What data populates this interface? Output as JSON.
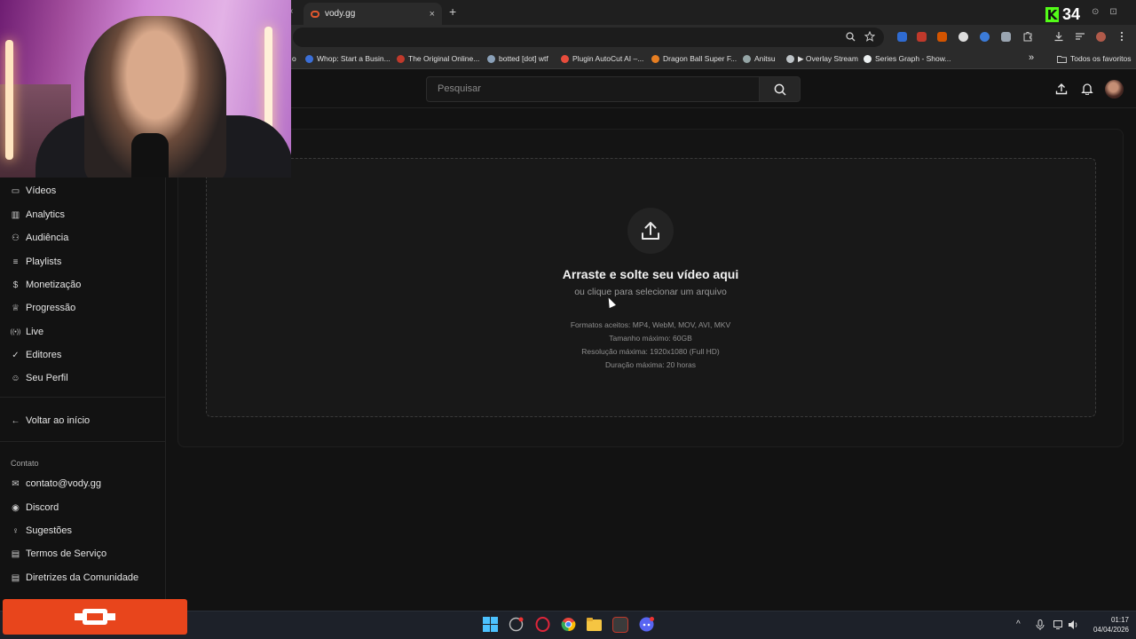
{
  "browser": {
    "tab_title": "vody.gg",
    "tab_close": "×",
    "new_tab": "+",
    "tab_back": "‹",
    "kick_count": "34",
    "bookmarks": [
      {
        "label": "Whop: Start a Busin...",
        "color": "#3b6fd8"
      },
      {
        "label": "The Original Online...",
        "color": "#c0392b"
      },
      {
        "label": "botted [dot] wtf",
        "color": "#8aa0b8"
      },
      {
        "label": "Plugin AutoCut AI –...",
        "color": "#e74c3c"
      },
      {
        "label": "Dragon Ball Super F...",
        "color": "#e67e22"
      },
      {
        "label": "Anitsu",
        "color": "#95a5a6"
      },
      {
        "label": "▶ Overlay Stream",
        "color": "#bdc3c7"
      },
      {
        "label": "Series Graph - Show...",
        "color": "#ecf0f1"
      }
    ],
    "bookmarks_more": "»",
    "bookmarks_all": "Todos os favoritos",
    "bookmark_partial": "o"
  },
  "topnav": {
    "search_placeholder": "Pesquisar"
  },
  "sidebar": {
    "items": [
      {
        "label": "Vídeos",
        "icon": "video-icon"
      },
      {
        "label": "Analytics",
        "icon": "chart-icon"
      },
      {
        "label": "Audiência",
        "icon": "users-icon"
      },
      {
        "label": "Playlists",
        "icon": "list-icon"
      },
      {
        "label": "Monetização",
        "icon": "dollar-icon"
      },
      {
        "label": "Progressão",
        "icon": "trophy-icon"
      },
      {
        "label": "Live",
        "icon": "broadcast-icon"
      },
      {
        "label": "Editores",
        "icon": "user-check-icon"
      },
      {
        "label": "Seu Perfil",
        "icon": "user-icon"
      }
    ],
    "back_label": "Voltar ao início",
    "contact_header": "Contato",
    "contact_items": [
      {
        "label": "contato@vody.gg",
        "icon": "mail-icon"
      },
      {
        "label": "Discord",
        "icon": "discord-icon"
      },
      {
        "label": "Sugestões",
        "icon": "lightbulb-icon"
      },
      {
        "label": "Termos de Serviço",
        "icon": "document-icon"
      },
      {
        "label": "Diretrizes da Comunidade",
        "icon": "document-icon"
      }
    ]
  },
  "upload": {
    "title": "Arraste e solte seu vídeo aqui",
    "subtitle": "ou clique para selecionar um arquivo",
    "info": [
      "Formatos aceitos: MP4, WebM, MOV, AVI, MKV",
      "Tamanho máximo: 60GB",
      "Resolução máxima: 1920x1080 (Full HD)",
      "Duração máxima: 20 horas"
    ]
  },
  "taskbar": {
    "time": "01:17",
    "date": "04/04/2026"
  },
  "colors": {
    "overlay_red": "#e8451c",
    "kick_green": "#53fc18",
    "page_bg": "#121212"
  }
}
